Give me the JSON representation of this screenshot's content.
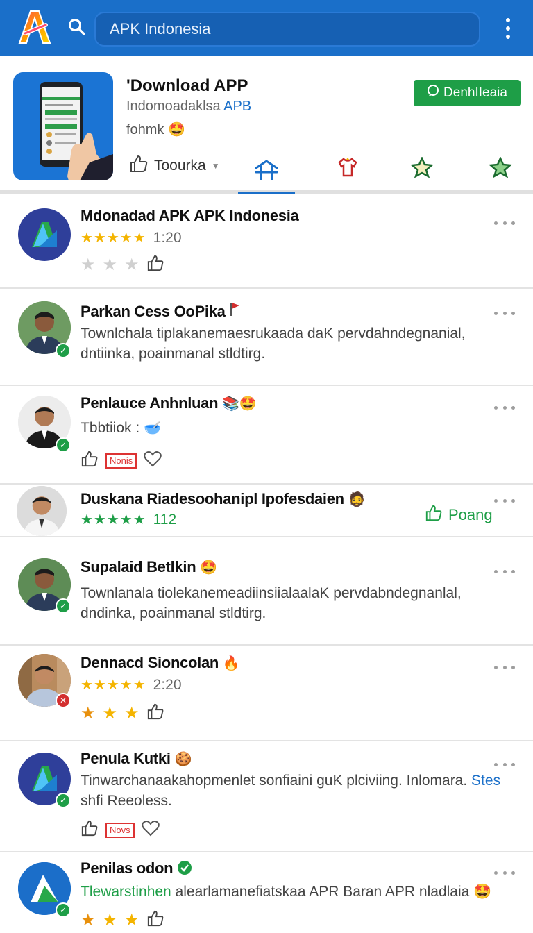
{
  "header": {
    "search_placeholder": "APK Indonesia"
  },
  "app": {
    "title": "'Download APP",
    "subtitle_plain": "Indomoadaklsa ",
    "subtitle_accent": "APB",
    "meta": "fohmk 🤩",
    "download_label": "DenhIIeaia",
    "like_tab_label": "Toourka"
  },
  "items": [
    {
      "name": "Mdonadad APK APK Indonesia",
      "stars": "★★★★★",
      "rating": "1:20"
    },
    {
      "name": "Parkan Cess OoPika",
      "desc": "Townlchala tiplakanemaesrukaada daK pervdahndegnanial, dntiinka, poainmanal stldtirg."
    },
    {
      "name": "Penlauce Anhnluan",
      "sub": "Tbbtiiok :",
      "tag": "Nonis"
    },
    {
      "name": "Duskana Riadesoohanipl Ipofesdaien",
      "stars": "★★★★★",
      "rating": "112",
      "like_label": "Poang"
    },
    {
      "name": "Supalaid Betlkin",
      "desc": "Townlanala tiolekanemeadiinsiialaalaK pervdabndegnanlal, dndinka, poainmanal stldtirg."
    },
    {
      "name": "Dennacd Sioncolan",
      "stars": "★★★★★",
      "rating": "2:20"
    },
    {
      "name": "Penula Kutki",
      "desc_plain": "Tinwarchanaakahopmenlet sonfiaini guK plciviing. Inlomara. ",
      "desc_accent": "Stes",
      "desc_plain2": "shfi Reeoless.",
      "tag": "Novs"
    },
    {
      "name": "Penilas odon",
      "desc_green": "Tlewarstinhen",
      "desc_plain": " alearlamanefiatskaa APR Baran APR nladlaia 🤩"
    }
  ],
  "colors": {
    "brand_blue": "#1a6fc9",
    "green": "#1e9e47",
    "star_gold": "#f4b400",
    "tag_red": "#dd3333"
  }
}
